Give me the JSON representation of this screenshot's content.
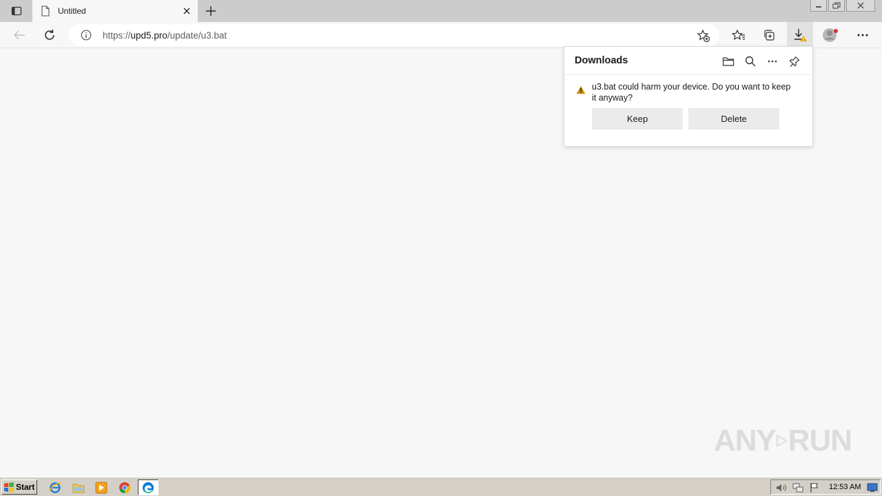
{
  "browser": {
    "tab": {
      "title": "Untitled"
    },
    "address": {
      "scheme": "https://",
      "host": "upd5.pro",
      "path": "/update/u3.bat"
    }
  },
  "downloads": {
    "title": "Downloads",
    "warning_message": "u3.bat could harm your device. Do you want to keep it anyway?",
    "keep_label": "Keep",
    "delete_label": "Delete"
  },
  "watermark": {
    "left": "ANY",
    "right": "RUN"
  },
  "taskbar": {
    "start_label": "Start",
    "clock": "12:53 AM"
  },
  "colors": {
    "warning": "#c99000",
    "edge_blue": "#0c7bd4"
  }
}
